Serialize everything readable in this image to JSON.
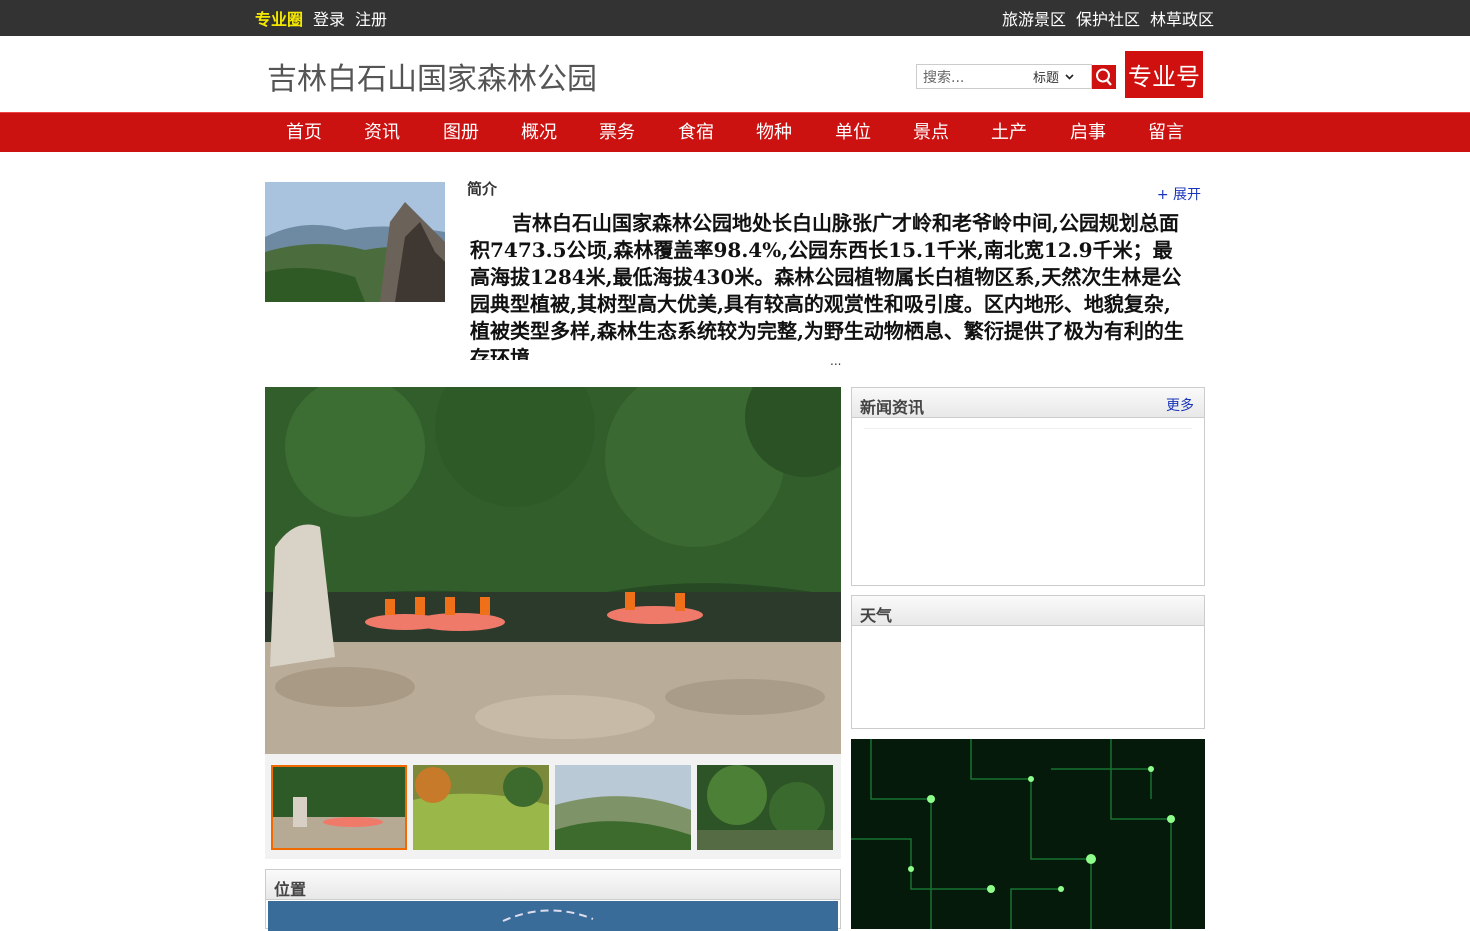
{
  "topbar": {
    "brand": "专业圈",
    "login": "登录",
    "register": "注册",
    "right_links": [
      "旅游景区",
      "保护社区",
      "林草政区"
    ]
  },
  "header": {
    "site_title": "吉林白石山国家森林公园",
    "search_placeholder": "搜索...",
    "search_scope": "标题",
    "badge": "专业号"
  },
  "nav": {
    "items": [
      "首页",
      "资讯",
      "图册",
      "概况",
      "票务",
      "食宿",
      "物种",
      "单位",
      "景点",
      "土产",
      "启事",
      "留言"
    ]
  },
  "intro": {
    "label": "简介",
    "expand": "+ 展开",
    "text": "吉林白石山国家森林公园地处长白山脉张广才岭和老爷岭中间,公园规划总面积7473.5公顷,森林覆盖率98.4%,公园东西长15.1千米,南北宽12.9千米；最高海拔1284米,最低海拔430米。森林公园植物属长白植物区系,天然次生林是公园典型植被,其树型高大优美,具有较高的观赏性和吸引度。区内地形、地貌复杂,植被类型多样,森林生态系统较为完整,为野生动物栖息、繁衍提供了极为有利的生存环境",
    "ellipsis": "..."
  },
  "panels": {
    "news": {
      "title": "新闻资讯",
      "more": "更多"
    },
    "weather": {
      "title": "天气"
    },
    "location": {
      "title": "位置"
    }
  },
  "colors": {
    "nav_red": "#cc1111",
    "brand_yellow": "#f5e800",
    "link_blue": "#1a35b8",
    "active_thumb": "#f06a00"
  }
}
